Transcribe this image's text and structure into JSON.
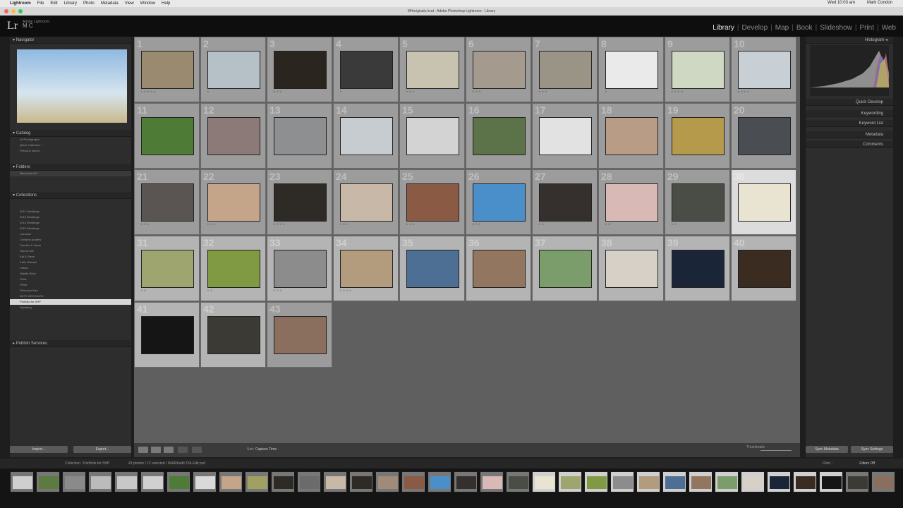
{
  "menubar": {
    "app": "Lightroom",
    "items": [
      "File",
      "Edit",
      "Library",
      "Photo",
      "Metadata",
      "View",
      "Window",
      "Help"
    ],
    "clock": "Wed 10:03 am",
    "user": "Mark Condon"
  },
  "window": {
    "title": "MHoriginals.lrcat - Adobe Photoshop Lightroom - Library"
  },
  "identity_plate": {
    "logo": "Lr",
    "line1": "Adobe Lightroom",
    "line2": "M C"
  },
  "modules": [
    "Library",
    "Develop",
    "Map",
    "Book",
    "Slideshow",
    "Print",
    "Web"
  ],
  "active_module": "Library",
  "left_panel": {
    "navigator": "Navigator",
    "catalog": "Catalog",
    "catalog_rows": [
      "All Photographs",
      "Quick Collection +",
      "Previous Import"
    ],
    "folders": "Folders",
    "folder_rows": [
      "Macintosh HD"
    ],
    "collections": "Collections",
    "collection_rows": [
      "2012 Weddings",
      "2013 Weddings",
      "2014 Weddings",
      "2015 Weddings",
      "Carousel",
      "Christine Andrew",
      "Candice & Jason",
      "Hanna Seb",
      "Kat & Steve",
      "Katie Michael",
      "Leticia",
      "Natalie Brian",
      "Picks",
      "Prints",
      "Rhiannon Alex",
      "BEST WEDDINGS",
      "Portfolio for SHP",
      "Speaking"
    ],
    "publish": "Publish Services",
    "import_label": "Import...",
    "export_label": "Export..."
  },
  "grid": {
    "cell_numbers": [
      "1",
      "2",
      "3",
      "4",
      "5",
      "6",
      "7",
      "8",
      "9",
      "10",
      "11",
      "12",
      "13",
      "14",
      "15",
      "16",
      "17",
      "18",
      "19",
      "20",
      "21",
      "22",
      "23",
      "24",
      "25",
      "26",
      "27",
      "28",
      "29",
      "30",
      "31",
      "32",
      "33",
      "34",
      "35",
      "36",
      "37",
      "38",
      "39",
      "40",
      "41",
      "42",
      "43"
    ],
    "cell_colors": [
      "#9a8a70",
      "#b5c1c7",
      "#2b2520",
      "#3a3a3a",
      "#c8c3b0",
      "#a49b8e",
      "#9a9486",
      "#eaeaea",
      "#cfd8c2",
      "#c8d0d6",
      "#4e7b36",
      "#8c7a78",
      "#8d8f91",
      "#c7ccd0",
      "#d3d3d3",
      "#5c7248",
      "#e2e2e2",
      "#b89c86",
      "#b49a4a",
      "#4a4d52",
      "#5a5552",
      "#c4a58a",
      "#2e2a26",
      "#c8b8a8",
      "#8a5a45",
      "#4a8fc9",
      "#35302d",
      "#d9b9b6",
      "#4a4d45",
      "#e9e4d2",
      "#9ea56e",
      "#7f9a43",
      "#8c8c8c",
      "#b39b7d",
      "#4d6f94",
      "#927660",
      "#7b9c6b",
      "#d7d0c6",
      "#1b2538",
      "#3a2c21",
      "#151515",
      "#3c3a35",
      "#8a6e5e"
    ],
    "selected": [
      30,
      31,
      32,
      33,
      34,
      35,
      36,
      37,
      38,
      39,
      40,
      41
    ],
    "stars": [
      "☆☆☆☆☆",
      "☆",
      "☆☆☆",
      "☆",
      "☆☆☆",
      "☆☆☆",
      "☆☆☆",
      "☆",
      "☆☆☆☆",
      "☆☆☆☆",
      "",
      "",
      "",
      "",
      "",
      "",
      "",
      "",
      "",
      "",
      "☆☆☆",
      "☆☆☆",
      "☆☆☆☆",
      "☆☆☆",
      "☆☆☆",
      "☆☆☆",
      "☆☆",
      "☆☆",
      "☆☆",
      "",
      "☆☆",
      "☆☆",
      "☆☆☆",
      "☆☆☆☆",
      "",
      "",
      "",
      "",
      "",
      "",
      "",
      "",
      ""
    ]
  },
  "toolbar": {
    "sort_label": "Sort:",
    "sort_value": "Capture Time",
    "thumbnails_label": "Thumbnails"
  },
  "right_panel": {
    "histogram": "Histogram",
    "quick_develop": "Quick Develop",
    "keywording": "Keywording",
    "keyword_list": "Keyword List",
    "metadata": "Metadata",
    "comments": "Comments",
    "sync_metadata": "Sync Metadata",
    "sync_settings": "Sync Settings"
  },
  "filmbar": {
    "source": "Collection : Portfolio for SHP",
    "count": "43 photos / 12 selected / IMARKedit 156 Edit.psd",
    "filter_label": "Filter :",
    "filter_value": "Filters Off"
  },
  "filmstrip_colors": [
    "#cfcfcf",
    "#5d7a40",
    "#8a8a8a",
    "#bbbbbb",
    "#c8c8c8",
    "#d0d0d0",
    "#4e7b36",
    "#d9d9d9",
    "#c4a58a",
    "#a0a062",
    "#2e2a26",
    "#6b6b6b",
    "#c8b8a8",
    "#2e2a26",
    "#a08a78",
    "#8a5a45",
    "#4a8fc9",
    "#35302d",
    "#d9b9b6",
    "#4a4d45",
    "#e9e4d2",
    "#9ea56e",
    "#7f9a43",
    "#8c8c8c",
    "#b39b7d",
    "#4d6f94",
    "#927660",
    "#7b9c6b",
    "#d7d0c6",
    "#1b2538",
    "#3a2c21",
    "#151515",
    "#3c3a35",
    "#8a6e5e"
  ]
}
